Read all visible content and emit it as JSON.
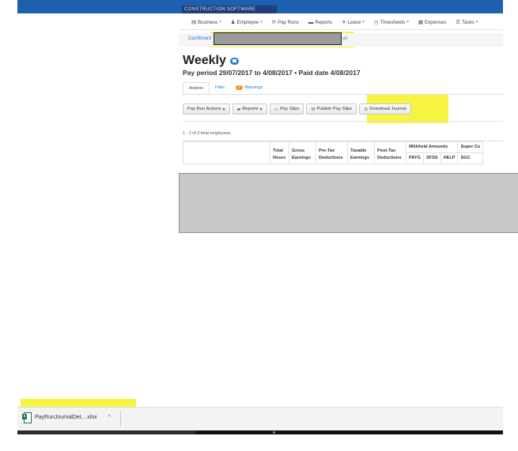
{
  "app": {
    "brand": "CONSTRUCTION SOFTWARE"
  },
  "nav": {
    "items": [
      {
        "label": "Business",
        "icon": "building-icon",
        "glyph": "▤",
        "caret": true
      },
      {
        "label": "Employee",
        "icon": "user-icon",
        "glyph": "♟",
        "caret": true
      },
      {
        "label": "Pay Runs",
        "icon": "refresh-icon",
        "glyph": "⟳",
        "caret": false
      },
      {
        "label": "Reports",
        "icon": "folder-icon",
        "glyph": "▬",
        "caret": false
      },
      {
        "label": "Leave",
        "icon": "plane-icon",
        "glyph": "✈",
        "caret": true
      },
      {
        "label": "Timesheets",
        "icon": "clock-icon",
        "glyph": "◷",
        "caret": true
      },
      {
        "label": "Expenses",
        "icon": "receipt-icon",
        "glyph": "▦",
        "caret": false
      },
      {
        "label": "Tasks",
        "icon": "list-icon",
        "glyph": "☰",
        "caret": true
      }
    ]
  },
  "breadcrumb": {
    "first": "Dashboard",
    "tail": "un"
  },
  "page": {
    "title": "Weekly",
    "period": "Pay period 29/07/2017 to 4/08/2017 • Paid date 4/08/2017"
  },
  "tabs": [
    {
      "label": "Actions",
      "active": true
    },
    {
      "label": "Filter",
      "active": false
    },
    {
      "label": "Warnings",
      "badge": "2",
      "active": false
    }
  ],
  "toolbar": {
    "pay_run_actions": "Pay Run Actions",
    "reports": "Reports",
    "pay_slips": "Pay Slips",
    "publish_pay_slips": "Publish Pay Slips",
    "download_journal": "Download Journal"
  },
  "summary": {
    "range": "1 - 3",
    "text": " of 3 total employees."
  },
  "table": {
    "headers_top": [
      "",
      "Total Hours",
      "Gross Earnings",
      "Pre-Tax Deductions",
      "Taxable Earnings",
      "Post-Tax Deductions",
      "Withheld Amounts",
      "Super Co"
    ],
    "headers_sub": [
      "PAYG",
      "SFSS",
      "HELP",
      "SGC"
    ]
  },
  "download": {
    "filename": "PayRunJournalDet....xlsx",
    "caret": "^"
  },
  "colors": {
    "accent": "#2a7fc9",
    "header": "#1f5fb0",
    "highlight": "#f4f21d",
    "badge": "#f0901e"
  }
}
